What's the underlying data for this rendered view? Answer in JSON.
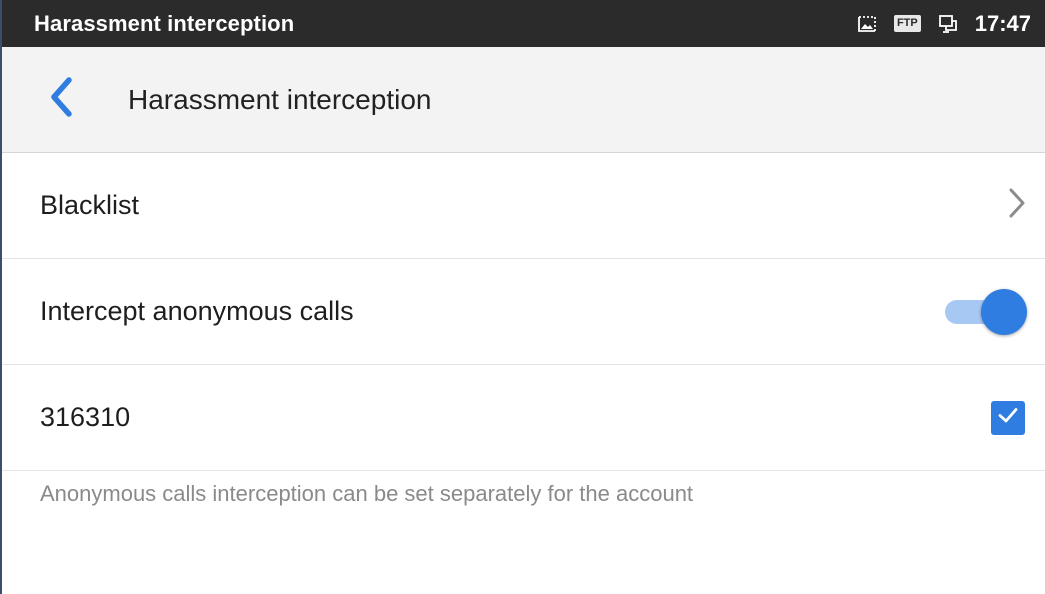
{
  "status_bar": {
    "title": "Harassment interception",
    "icons": [
      "screenshot-icon",
      "ftp-icon",
      "network-icon"
    ],
    "ftp_label": "FTP",
    "time": "17:47"
  },
  "app_bar": {
    "back_icon": "chevron-left-icon",
    "title": "Harassment interception"
  },
  "settings": {
    "blacklist": {
      "label": "Blacklist",
      "icon": "chevron-right-icon"
    },
    "intercept_anonymous": {
      "label": "Intercept anonymous calls",
      "enabled": true
    },
    "account": {
      "label": "316310",
      "checked": true
    },
    "hint": "Anonymous calls interception can be set separately for the account"
  },
  "colors": {
    "accent": "#2f7de1",
    "accent_light": "#a6c8f3",
    "status_bar_bg": "#2b2b2b",
    "app_bar_bg": "#f3f3f3",
    "hint_text": "#8a8a8a"
  }
}
